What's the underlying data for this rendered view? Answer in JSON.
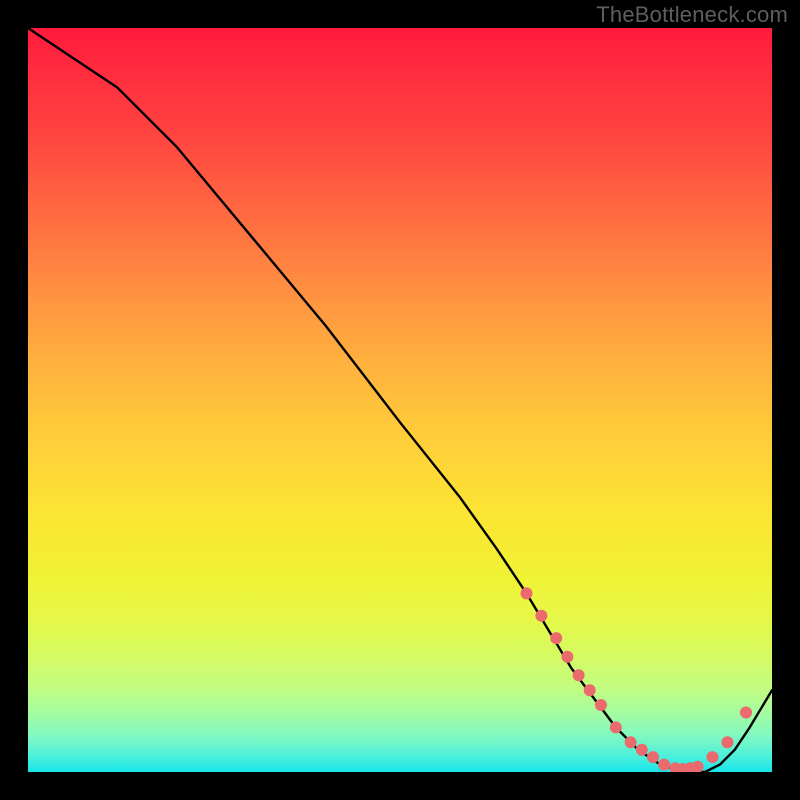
{
  "watermark": "TheBottleneck.com",
  "chart_data": {
    "type": "line",
    "title": "",
    "xlabel": "",
    "ylabel": "",
    "xlim": [
      0,
      100
    ],
    "ylim": [
      0,
      100
    ],
    "series": [
      {
        "name": "bottleneck-curve",
        "x": [
          0,
          6,
          12,
          20,
          30,
          40,
          50,
          58,
          63,
          67,
          70,
          73,
          76,
          79,
          82,
          85,
          88,
          91,
          93,
          95,
          97,
          100
        ],
        "y": [
          100,
          96,
          92,
          84,
          72,
          60,
          47,
          37,
          30,
          24,
          19,
          14,
          10,
          6,
          3,
          1,
          0,
          0,
          1,
          3,
          6,
          11
        ]
      }
    ],
    "markers": {
      "name": "highlight-points",
      "x": [
        67,
        69,
        71,
        72.5,
        74,
        75.5,
        77,
        79,
        81,
        82.5,
        84,
        85.5,
        87,
        88,
        89,
        90,
        92,
        94,
        96.5
      ],
      "y": [
        24,
        21,
        18,
        15.5,
        13,
        11,
        9,
        6,
        4,
        3,
        2,
        1,
        0.5,
        0.4,
        0.5,
        0.7,
        2,
        4,
        8
      ]
    },
    "gradient": {
      "top_color": "#ff1b3c",
      "mid_color": "#ffd039",
      "bottom_color": "#18e4eb"
    }
  }
}
